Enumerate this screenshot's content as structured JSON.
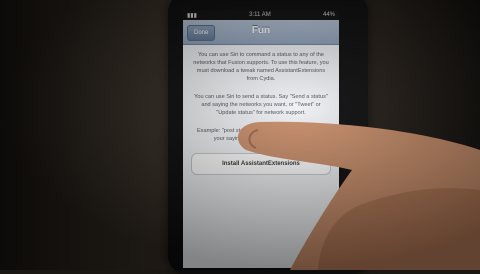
{
  "status_bar": {
    "time": "3:11 AM",
    "battery": "44%"
  },
  "nav": {
    "back_label": "Done",
    "title": "Fun"
  },
  "paragraphs": [
    "You can use Siri to command a status to any of the networks that Fusion supports. To use this feature, you must download a tweak named AssistantExtensions from Cydia.",
    "You can use Siri to send a status. Say \"Send a status\" and saying the networks you want, or \"Tweet\" or \"Update status\" for network support.",
    "Example: \"post status to Facebook, Twitter, and say your saying\" — will work name is Billy."
  ],
  "install_button": "Install AssistantExtensions",
  "colors": {
    "nav_top": "#b9c7d8",
    "nav_bottom": "#8ea2bb",
    "screen_bg": "#eef0f3",
    "skin": "#c98e6a"
  }
}
